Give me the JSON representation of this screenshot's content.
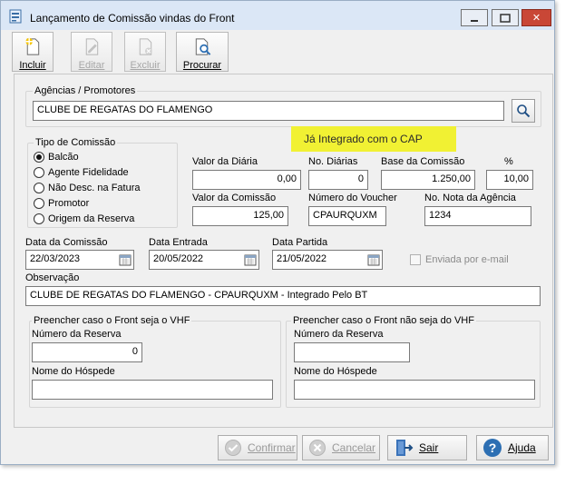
{
  "window": {
    "title": "Lançamento de Comissão vindas do Front",
    "controls": {
      "minimize": "minimize",
      "maximize": "maximize",
      "close": "✕"
    }
  },
  "toolbar": {
    "incluir": "Incluir",
    "editar": "Editar",
    "excluir": "Excluir",
    "procurar": "Procurar"
  },
  "agencias": {
    "label": "Agências  / Promotores",
    "value": "CLUBE DE REGATAS DO FLAMENGO"
  },
  "status_highlight": "Já Integrado com o CAP",
  "tipo_comissao": {
    "label": "Tipo de Comissão",
    "options": [
      "Balcão",
      "Agente Fidelidade",
      "Não Desc. na Fatura",
      "Promotor",
      "Origem da Reserva"
    ],
    "selected": "Balcão"
  },
  "fields": {
    "valor_diaria": {
      "label": "Valor da Diária",
      "value": "0,00"
    },
    "no_diarias": {
      "label": "No. Diárias",
      "value": "0"
    },
    "base_comissao": {
      "label": "Base da Comissão",
      "value": "1.250,00"
    },
    "percent": {
      "label": "%",
      "value": "10,00"
    },
    "valor_comissao": {
      "label": "Valor da Comissão",
      "value": "125,00"
    },
    "numero_voucher": {
      "label": "Número do Voucher",
      "value": "CPAURQUXM"
    },
    "nota_agencia": {
      "label": "No. Nota da Agência",
      "value": "1234"
    },
    "data_comissao": {
      "label": "Data da Comissão",
      "value": "22/03/2023"
    },
    "data_entrada": {
      "label": "Data Entrada",
      "value": "20/05/2022"
    },
    "data_partida": {
      "label": "Data Partida",
      "value": "21/05/2022"
    },
    "enviada_email": {
      "label": "Enviada por e-mail",
      "checked": false
    },
    "observacao": {
      "label": "Observação",
      "value": "CLUBE DE REGATAS DO FLAMENGO - CPAURQUXM -  Integrado Pelo BT"
    }
  },
  "vhf": {
    "label": "Preencher caso o Front seja o VHF",
    "numero_label": "Número da Reserva",
    "numero_value": "0",
    "hospede_label": "Nome do Hóspede",
    "hospede_value": ""
  },
  "nao_vhf": {
    "label": "Preencher caso o Front não seja do VHF",
    "numero_label": "Número da Reserva",
    "numero_value": "",
    "hospede_label": "Nome do Hóspede",
    "hospede_value": ""
  },
  "footer": {
    "confirmar": "Confirmar",
    "cancelar": "Cancelar",
    "sair": "Sair",
    "ajuda": "Ajuda"
  },
  "colors": {
    "highlight": "#f1f133",
    "titlebar": "#dbe7f6",
    "close_button": "#c94736",
    "help_icon": "#2d6fb3",
    "confirm_icon": "#8fbf3f"
  }
}
